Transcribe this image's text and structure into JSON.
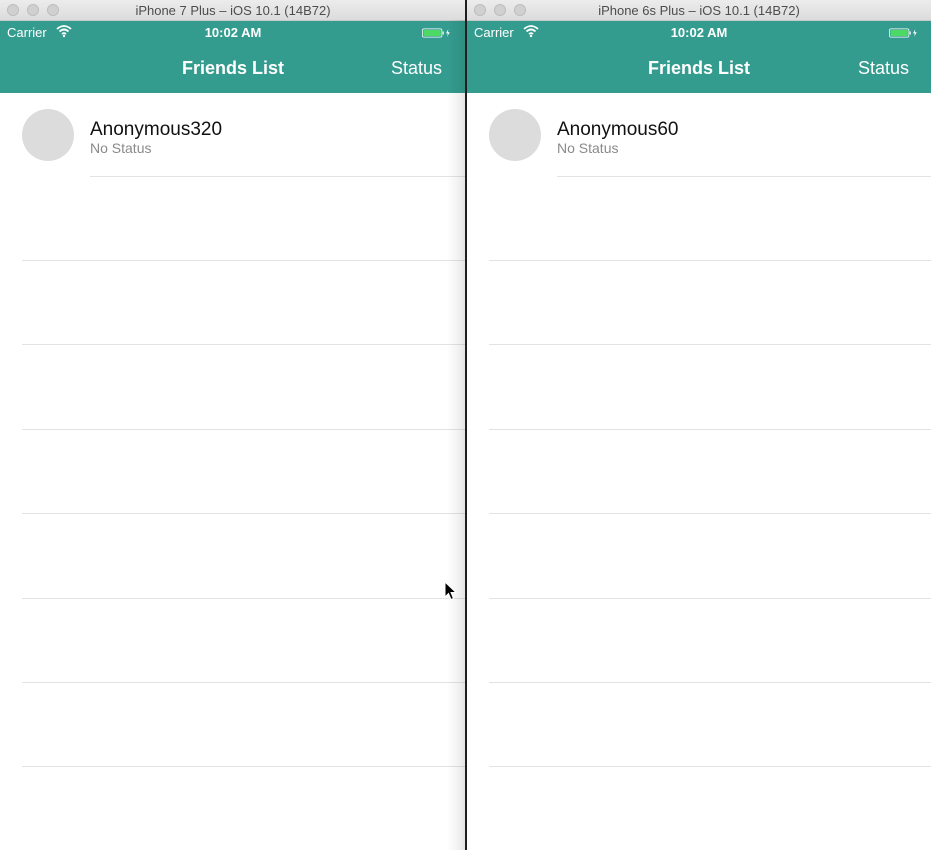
{
  "simulators": [
    {
      "window_title": "iPhone 7 Plus – iOS 10.1 (14B72)",
      "status_bar": {
        "carrier": "Carrier",
        "time": "10:02 AM"
      },
      "nav": {
        "title": "Friends List",
        "right_button": "Status"
      },
      "friends": [
        {
          "name": "Anonymous320",
          "status": "No Status"
        }
      ]
    },
    {
      "window_title": "iPhone 6s Plus – iOS 10.1 (14B72)",
      "status_bar": {
        "carrier": "Carrier",
        "time": "10:02 AM"
      },
      "nav": {
        "title": "Friends List",
        "right_button": "Status"
      },
      "friends": [
        {
          "name": "Anonymous60",
          "status": "No Status"
        }
      ]
    }
  ],
  "colors": {
    "header": "#349c8f",
    "battery": "#4cd964",
    "separator": "#e3e3e3"
  },
  "icons": [
    "wifi-icon",
    "battery-icon",
    "mouse-cursor-icon"
  ]
}
